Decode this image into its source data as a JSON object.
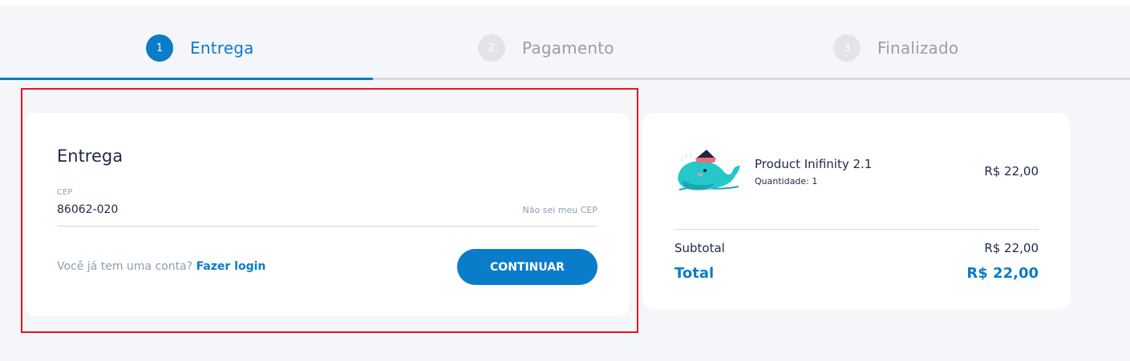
{
  "stepper": {
    "steps": [
      {
        "number": "1",
        "label": "Entrega",
        "state": "active"
      },
      {
        "number": "2",
        "label": "Pagamento",
        "state": "inactive"
      },
      {
        "number": "3",
        "label": "Finalizado",
        "state": "inactive"
      }
    ],
    "progress": 0.33
  },
  "delivery": {
    "title": "Entrega",
    "cep_label": "CEP",
    "cep_value": "86062-020",
    "cep_help": "Não sei meu CEP",
    "account_question": "Você já tem uma conta?",
    "login_link": "Fazer login",
    "continue_label": "CONTINUAR"
  },
  "summary": {
    "product": {
      "image_icon": "whale-product-image",
      "name": "Product Inifinity 2.1",
      "quantity": "Quantidade: 1",
      "price": "R$ 22,00"
    },
    "subtotal_label": "Subtotal",
    "subtotal_value": "R$ 22,00",
    "total_label": "Total",
    "total_value": "R$ 22,00"
  },
  "colors": {
    "accent": "#0a7cc9",
    "highlight": "#e8141a",
    "background": "#f4f6f9"
  }
}
